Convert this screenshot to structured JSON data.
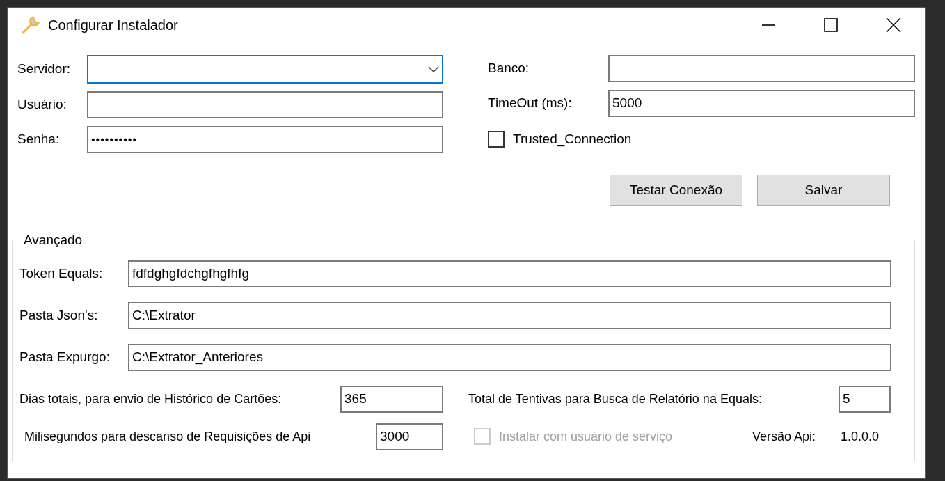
{
  "window": {
    "title": "Configurar Instalador"
  },
  "connection_fields": [
    {
      "label": "Servidor:",
      "kind": "combo",
      "focused": true
    },
    {
      "label": "Usuário:",
      "kind": "text",
      "focused": false
    },
    {
      "label": "Senha:",
      "kind": "password",
      "value": "••••••••••",
      "focused": false
    }
  ],
  "database_fields": [
    {
      "label": "Banco:"
    },
    {
      "label": "TimeOut (ms):",
      "value": "5000"
    }
  ],
  "trusted_connection": {
    "label": "Trusted_Connection",
    "checked": false
  },
  "buttons": [
    "Testar Conexão",
    "Salvar"
  ],
  "advanced": {
    "title": "Avançado",
    "paths": [
      {
        "label": "Token Equals:",
        "value": "fdfdghgfdchgfhgfhfg"
      },
      {
        "label": "Pasta Json's:",
        "value": "C:\\Extrator"
      },
      {
        "label": "Pasta Expurgo:",
        "value": "C:\\Extrator_Anteriores"
      }
    ],
    "history_days": {
      "label": "Dias totais, para envio de Histórico de Cartões:",
      "value": "365"
    },
    "report_attempts": {
      "label": "Total de Tentivas para Busca de Relatório na Equals:",
      "value": "5"
    },
    "request_delay": {
      "label": "Milisegundos para descanso de Requisições de Api",
      "value": "3000"
    },
    "service_user": {
      "label": "Instalar com usuário de serviço",
      "checked": false,
      "disabled": true
    },
    "api_version": {
      "label": "Versão Api:",
      "value": "1.0.0.0"
    }
  }
}
